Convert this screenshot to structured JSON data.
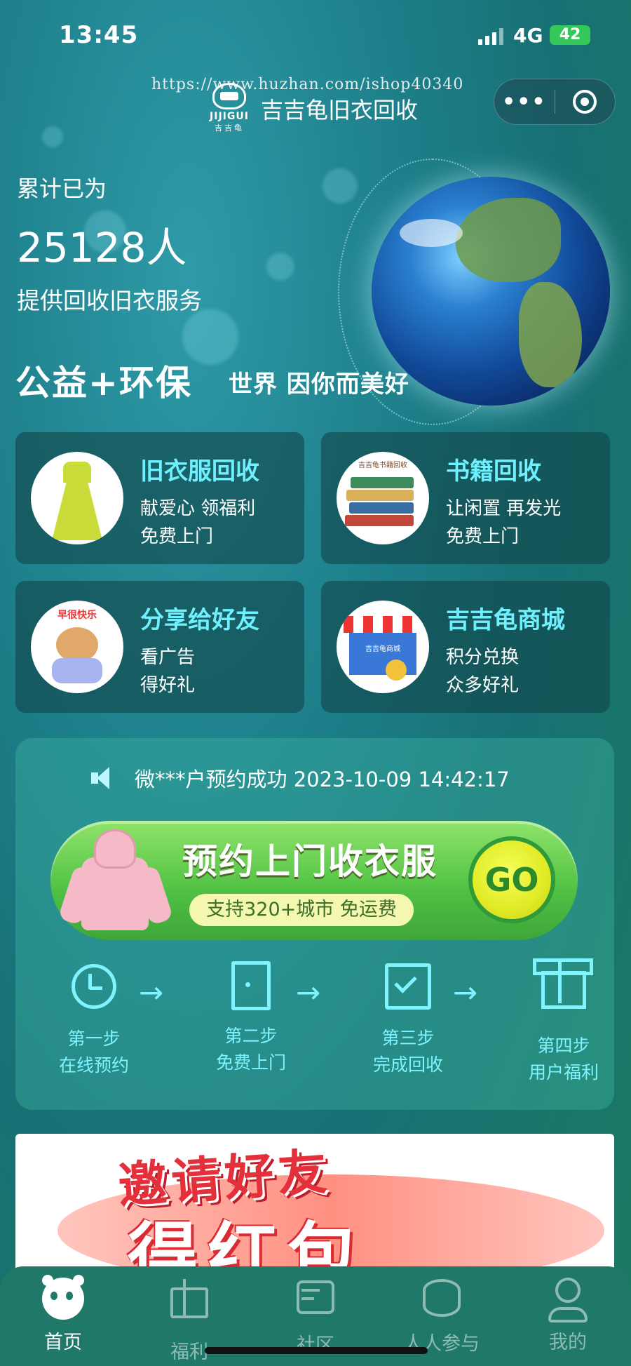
{
  "status_bar": {
    "time": "13:45",
    "network": "4G",
    "battery": "42"
  },
  "header": {
    "watermark": "https://www.huzhan.com/ishop40340",
    "logo_text": "JIJIGUI",
    "logo_sub": "吉吉龟",
    "title": "吉吉龟旧衣回收",
    "more_label": "•••"
  },
  "hero": {
    "line1": "累计已为",
    "count": "25128人",
    "line3": "提供回收旧衣服务",
    "slogan_main": "公益+环保",
    "slogan_sub": "世界 因你而美好"
  },
  "cards": [
    {
      "title": "旧衣服回收",
      "sub1": "献爱心 领福利",
      "sub2": "免费上门"
    },
    {
      "title": "书籍回收",
      "sub1": "让闲置 再发光",
      "sub2": "免费上门"
    },
    {
      "title": "分享给好友",
      "sub1": "看广告",
      "sub2": "得好礼"
    },
    {
      "title": "吉吉龟商城",
      "sub1": "积分兑换",
      "sub2": "众多好礼"
    }
  ],
  "card_thumbs": {
    "books_label": "吉吉龟书籍回收",
    "store_label": "吉吉龟商城",
    "share_label": "早很快乐"
  },
  "order": {
    "notice": "微***户预约成功 2023-10-09 14:42:17",
    "button_title": "预约上门收衣服",
    "button_pill": "支持320+城市  免运费",
    "go_label": "GO"
  },
  "steps": [
    {
      "step": "第一步",
      "label": "在线预约",
      "icon": "alarm-clock-icon"
    },
    {
      "step": "第二步",
      "label": "免费上门",
      "icon": "door-icon"
    },
    {
      "step": "第三步",
      "label": "完成回收",
      "icon": "checkbox-icon"
    },
    {
      "step": "第四步",
      "label": "用户福利",
      "icon": "gift-icon"
    }
  ],
  "step_arrow": "→",
  "banner": {
    "line1": "邀请好友",
    "line2": "得红包"
  },
  "tabs": [
    {
      "label": "首页",
      "icon": "panda-home-icon",
      "active": true
    },
    {
      "label": "福利",
      "icon": "gift-icon",
      "active": false
    },
    {
      "label": "社区",
      "icon": "chat-icon",
      "active": false
    },
    {
      "label": "人人参与",
      "icon": "coins-icon",
      "active": false
    },
    {
      "label": "我的",
      "icon": "user-icon",
      "active": false
    }
  ],
  "colors": {
    "accent_cyan": "#6ff0ff",
    "green_button": "#4fc043",
    "go_yellow": "#e0ea25",
    "tab_bg": "#1f7868",
    "battery_green": "#34c759"
  }
}
